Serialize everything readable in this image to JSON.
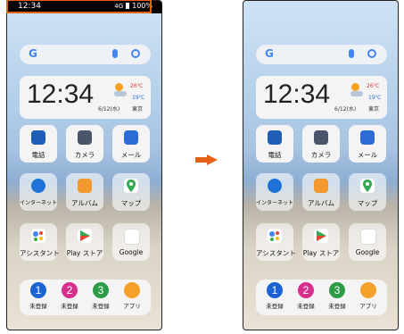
{
  "left": {
    "status_time": "12:34",
    "status_signal": "4G",
    "status_battery": "100%"
  },
  "clock": {
    "time": "12:34",
    "date": "6/12(水)",
    "temp_high": "26℃",
    "temp_low": "19℃",
    "city": "東京"
  },
  "apps": {
    "phone": "電話",
    "camera": "カメラ",
    "mail": "メール",
    "internet": "インターネット",
    "album": "アルバム",
    "map": "マップ",
    "assistant": "アシスタント",
    "playstore": "Play ストア",
    "google": "Google"
  },
  "dock": {
    "slot1_num": "1",
    "slot1_label": "未登録",
    "slot2_num": "2",
    "slot2_label": "未登録",
    "slot3_num": "3",
    "slot3_label": "未登録",
    "apps_label": "アプリ"
  },
  "colors": {
    "accent": "#e66018",
    "google_blue": "#4285f4"
  }
}
